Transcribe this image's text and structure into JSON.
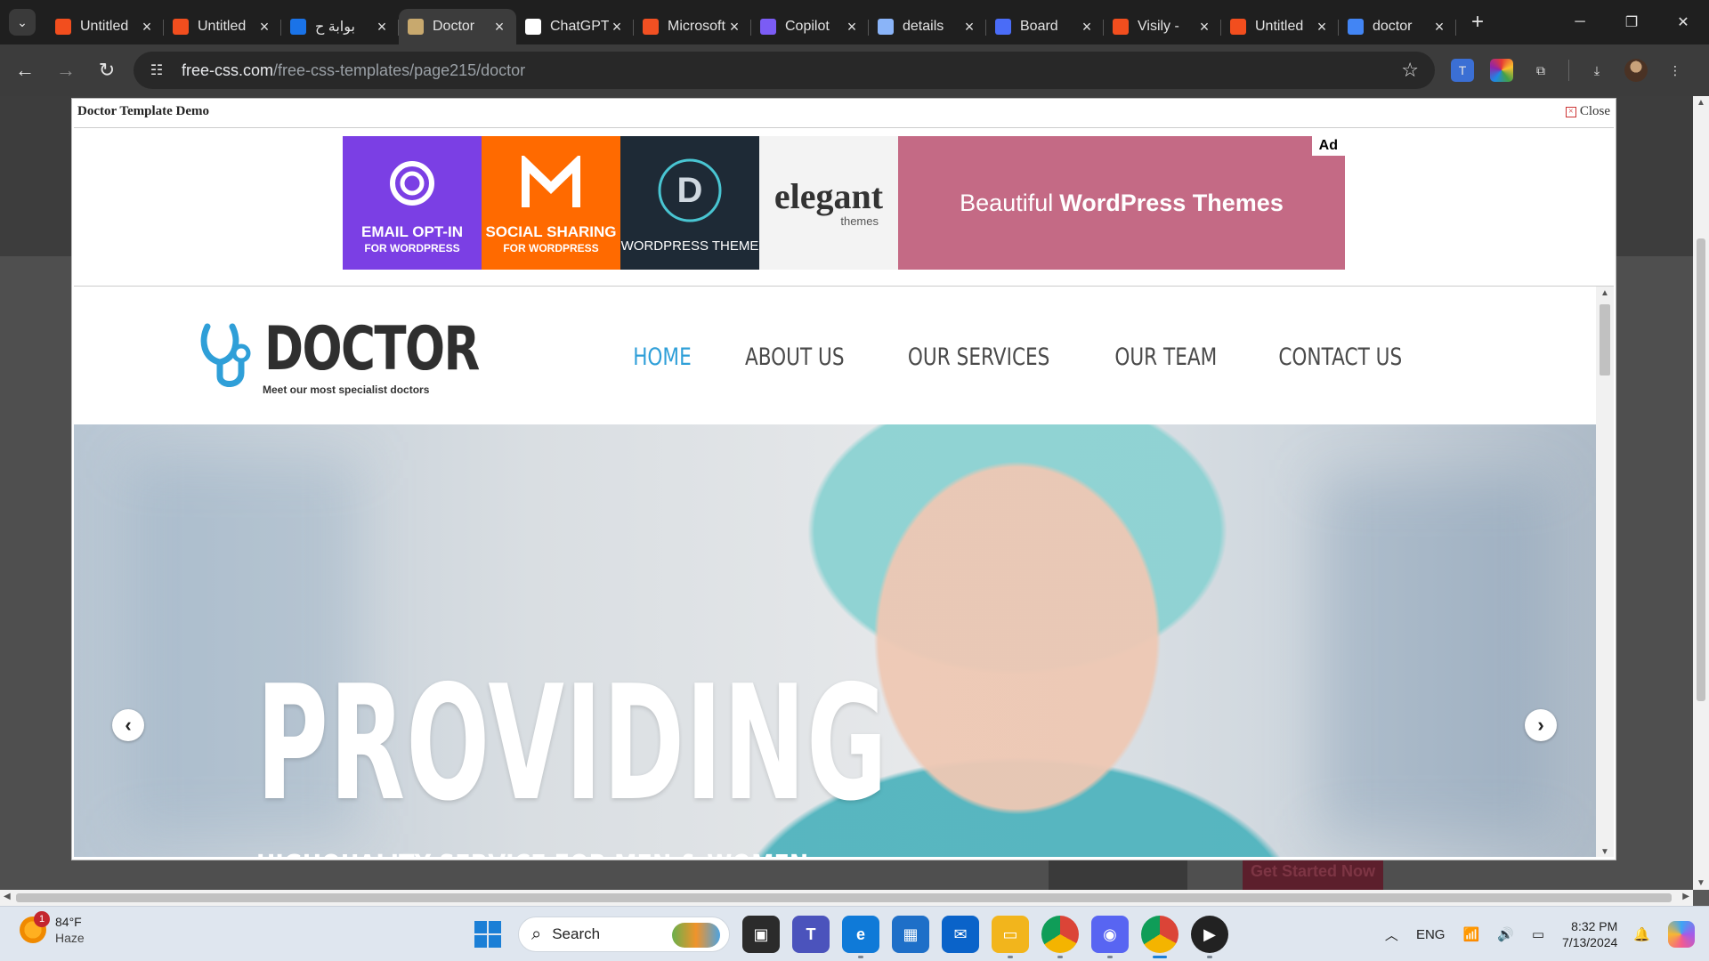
{
  "browser": {
    "tabs": [
      {
        "title": "Untitled",
        "icon": "figma-icon",
        "color": "#f24e1e",
        "active": false
      },
      {
        "title": "Untitled",
        "icon": "figma-icon",
        "color": "#f24e1e",
        "active": false
      },
      {
        "title": "بوابة ح",
        "icon": "portal-icon",
        "color": "#1a73e8",
        "active": false
      },
      {
        "title": "Doctor",
        "icon": "freecss-icon",
        "color": "#c8a96e",
        "active": true
      },
      {
        "title": "ChatGPT",
        "icon": "chatgpt-icon",
        "color": "#ffffff",
        "active": false
      },
      {
        "title": "Microsoft",
        "icon": "microsoft-icon",
        "color": "#f25022",
        "active": false
      },
      {
        "title": "Copilot",
        "icon": "copilot-icon",
        "color": "#7b5cf5",
        "active": false
      },
      {
        "title": "details",
        "icon": "search-icon",
        "color": "#8ab4f8",
        "active": false
      },
      {
        "title": "Board",
        "icon": "board-icon",
        "color": "#4a6cf7",
        "active": false
      },
      {
        "title": "Visily -",
        "icon": "figma-icon",
        "color": "#f24e1e",
        "active": false
      },
      {
        "title": "Untitled",
        "icon": "figma-icon",
        "color": "#f24e1e",
        "active": false
      },
      {
        "title": "doctor",
        "icon": "google-icon",
        "color": "#4285f4",
        "active": false
      }
    ],
    "url_host": "free-css.com",
    "url_path": "/free-css-templates/page215/doctor"
  },
  "lightbox": {
    "title": "Doctor Template Demo",
    "close_label": "Close"
  },
  "ad": {
    "tile1_l1": "EMAIL OPT-IN",
    "tile1_l2": "FOR WORDPRESS",
    "tile2_l1": "SOCIAL SHARING",
    "tile2_l2": "FOR WORDPRESS",
    "tile3_l1": "WORDPRESS THEME",
    "tile4_logo": "elegant",
    "tile4_sub": "themes",
    "banner_plain": "Beautiful",
    "banner_bold": "WordPress Themes",
    "badge": "Ad"
  },
  "site": {
    "brand": "DOCTOR",
    "tagline": "Meet our most specialist doctors",
    "nav": [
      "HOME",
      "ABOUT US",
      "OUR SERVICES",
      "OUR TEAM",
      "CONTACT US"
    ],
    "hero_title": "PROVIDING",
    "hero_sub": "HIGHQUALITY SERVICE FOR MEN & WOMEN",
    "accent": "#2f9fd8"
  },
  "background": {
    "cta_ghost": "Get Started Now"
  },
  "taskbar": {
    "temp": "84°F",
    "condition": "Haze",
    "weather_badge": "1",
    "search_label": "Search",
    "lang": "ENG",
    "time": "8:32 PM",
    "date": "7/13/2024"
  }
}
